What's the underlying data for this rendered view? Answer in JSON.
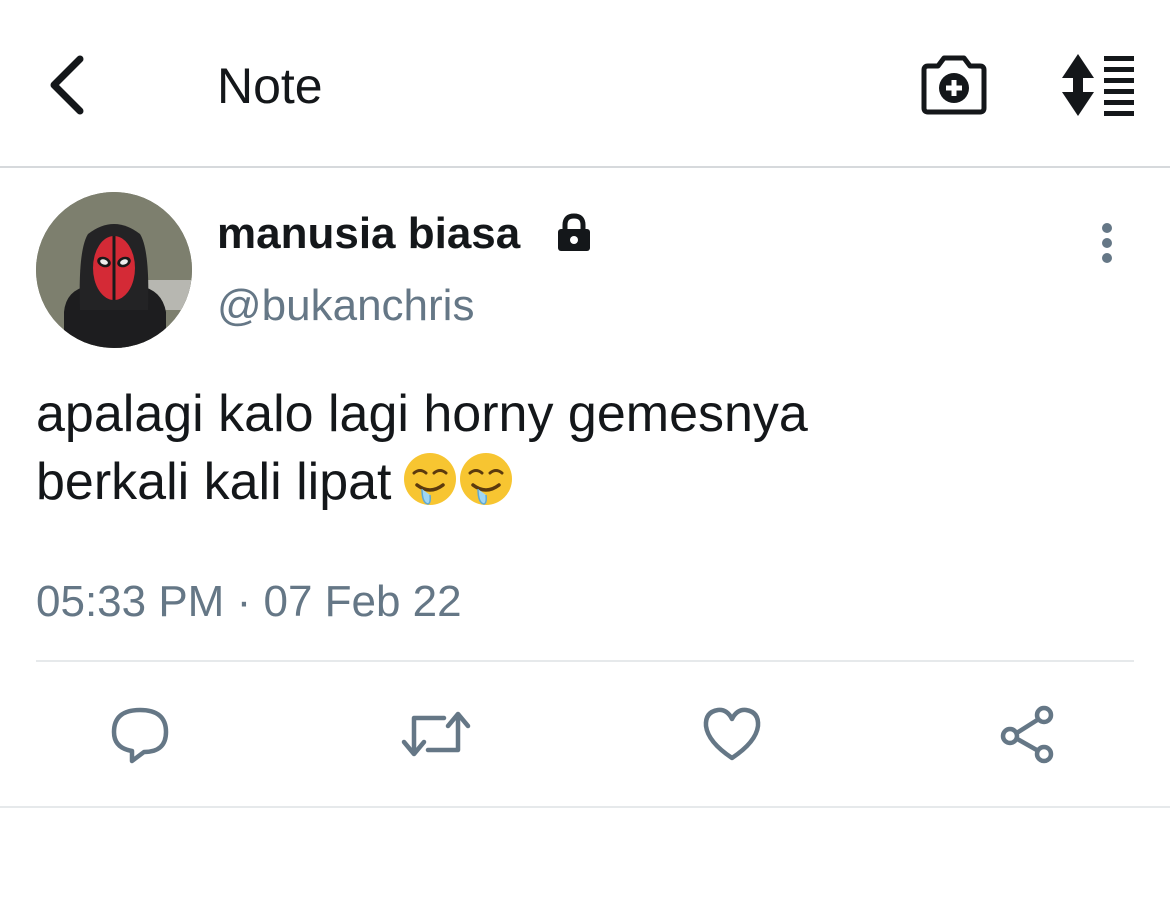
{
  "header": {
    "title": "Note",
    "back_icon": "chevron-left-icon",
    "camera_icon": "camera-add-icon",
    "sort_icon": "sort-list-icon"
  },
  "tweet": {
    "author": {
      "display_name": "manusia biasa",
      "username": "@bukanchris",
      "protected_icon": "lock-icon",
      "avatar_icon": "profile-avatar"
    },
    "text_lines": [
      "apalagi kalo lagi horny gemesnya",
      "berkali kali lipat"
    ],
    "emoji_icon": "drooling-face-emoji",
    "time": "05:33 PM",
    "separator": "·",
    "date": "07 Feb 22",
    "more_icon": "more-vertical-icon"
  },
  "actions": {
    "reply_icon": "reply-icon",
    "retweet_icon": "retweet-icon",
    "like_icon": "heart-icon",
    "share_icon": "share-icon"
  },
  "colors": {
    "text": "#14171a",
    "secondary": "#657786",
    "divider": "#e6e9eb",
    "avatar_mask": "#d42a36"
  }
}
